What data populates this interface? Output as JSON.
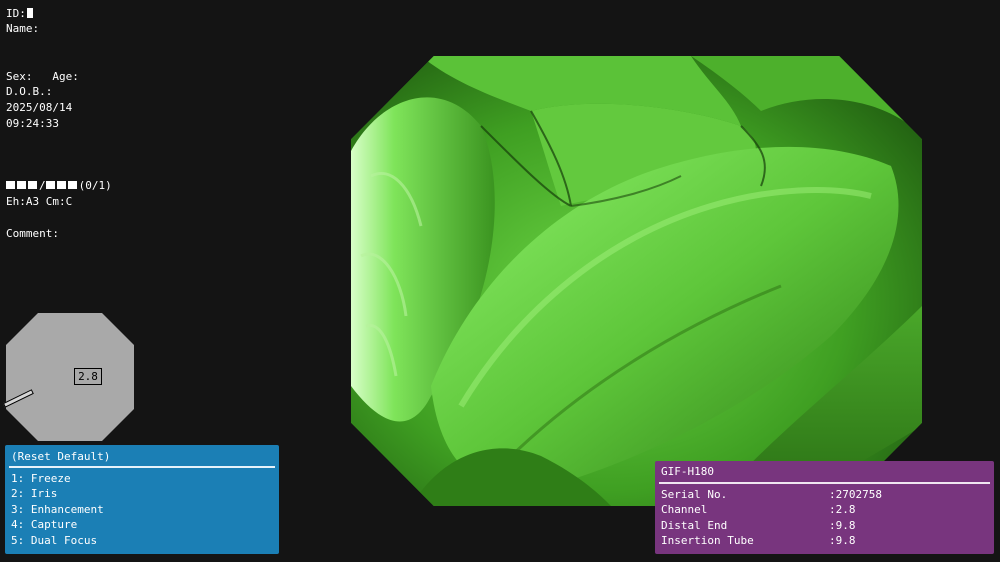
{
  "patient": {
    "id_label": "ID:",
    "name_label": "Name:",
    "sex_label": "Sex:",
    "age_label": "Age:",
    "dob_label": "D.O.B.:",
    "date": "2025/08/14",
    "time": "09:24:33",
    "record_counter": "(0/1)",
    "enhancement": "Eh:A3 Cm:C",
    "comment_label": "Comment:"
  },
  "scope_indicator": {
    "channel_value": "2.8"
  },
  "menu": {
    "title": "(Reset Default)",
    "items": [
      "1: Freeze",
      "2: Iris",
      "3: Enhancement",
      "4: Capture",
      "5: Dual Focus"
    ]
  },
  "device": {
    "model": "GIF-H180",
    "rows": [
      {
        "label": "Serial No.",
        "value": ":2702758"
      },
      {
        "label": "Channel",
        "value": ":2.8"
      },
      {
        "label": "Distal End",
        "value": ":9.8"
      },
      {
        "label": "Insertion Tube",
        "value": ":9.8"
      }
    ]
  },
  "colors": {
    "background": "#141414",
    "menu_panel": "#1b7fb5",
    "device_panel": "#78357e",
    "tissue": "#3a9a1e"
  }
}
